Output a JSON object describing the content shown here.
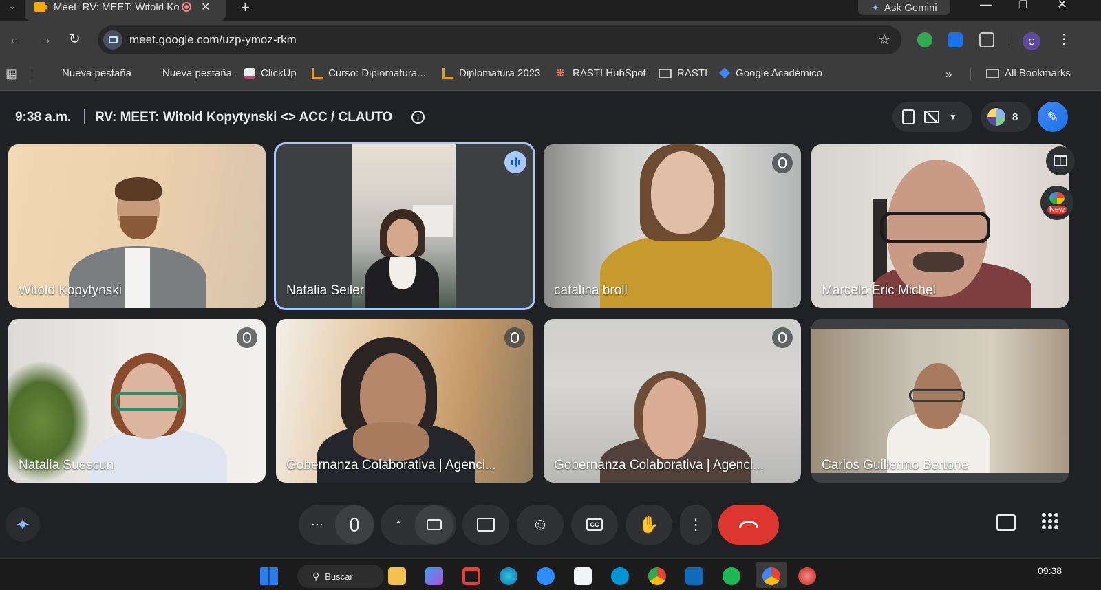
{
  "browser": {
    "tab_title": "Meet: RV: MEET: Witold Kop",
    "new_tab_glyph": "+",
    "ask_gemini_label": "Ask Gemini",
    "url": "meet.google.com/uzp-ymoz-rkm",
    "profile_initial": "C",
    "bookmarks": [
      {
        "label": "Nueva pestaña",
        "icon": "blank-page-icon"
      },
      {
        "label": "Nueva pestaña",
        "icon": "blank-page-icon"
      },
      {
        "label": "ClickUp",
        "icon": "clickup-icon"
      },
      {
        "label": "Curso: Diplomatura...",
        "icon": "course-icon"
      },
      {
        "label": "Diplomatura 2023",
        "icon": "course-icon"
      },
      {
        "label": "RASTI HubSpot",
        "icon": "hubspot-icon"
      },
      {
        "label": "RASTI",
        "icon": "folder-icon"
      },
      {
        "label": "Google Académico",
        "icon": "scholar-icon"
      }
    ],
    "all_bookmarks_label": "All Bookmarks"
  },
  "meeting": {
    "time": "9:38 a.m.",
    "title": "RV: MEET: Witold Kopytynski <> ACC / CLAUTO",
    "participant_count": "8",
    "new_badge": "New"
  },
  "participants": [
    {
      "name": "Witold Kopytynski",
      "muted": false,
      "speaking": false
    },
    {
      "name": "Natalia Seiler",
      "muted": false,
      "speaking": true
    },
    {
      "name": "catalina broll",
      "muted": true,
      "speaking": false
    },
    {
      "name": "Marcelo Eric Michel",
      "muted": false,
      "speaking": false
    },
    {
      "name": "Natalia Suescun",
      "muted": true,
      "speaking": false
    },
    {
      "name": "Gobernanza Colaborativa | Agenci...",
      "muted": true,
      "speaking": false
    },
    {
      "name": "Gobernanza Colaborativa | Agenci...",
      "muted": true,
      "speaking": false
    },
    {
      "name": "Carlos Guillermo Bertone",
      "muted": false,
      "speaking": false
    }
  ],
  "taskbar": {
    "search_label": "Buscar",
    "clock": "09:38"
  },
  "colors": {
    "end_call": "#dc362e",
    "active_outline": "#a8c7fa",
    "background": "#202124"
  }
}
